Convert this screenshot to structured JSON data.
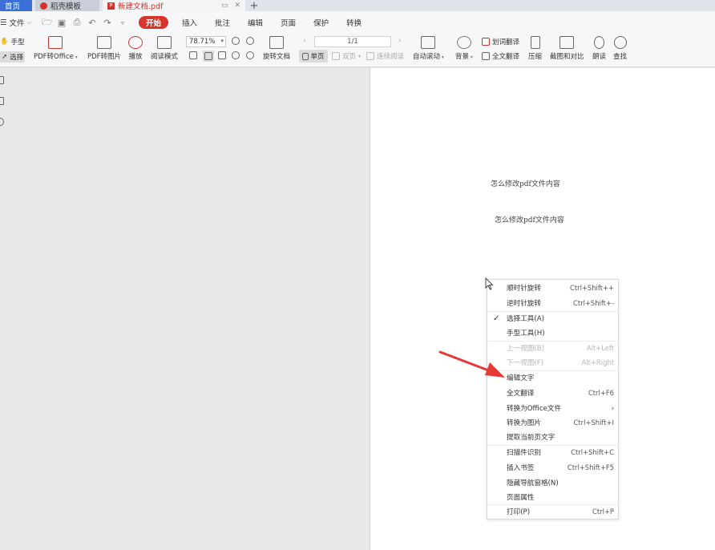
{
  "tabs": {
    "home": "首页",
    "template": "稻壳模板",
    "document": "新建文档.pdf"
  },
  "menu": {
    "file": "文件",
    "tabs": [
      "开始",
      "插入",
      "批注",
      "编辑",
      "页面",
      "保护",
      "转换"
    ]
  },
  "ribbon": {
    "hand_tool": "手型",
    "select_tool": "选择",
    "pdf_to_office": "PDF转Office",
    "pdf_to_image": "PDF转图片",
    "play": "播放",
    "read_mode": "阅读模式",
    "zoom_value": "78.71%",
    "rotate_doc": "旋转文档",
    "page_indicator": "1/1",
    "single_page": "单页",
    "double_page": "双页",
    "continuous_read": "连续阅读",
    "auto_scroll": "自动滚动",
    "background": "背景",
    "word_translate": "划词翻译",
    "full_translate": "全文翻译",
    "compress": "压缩",
    "screenshot_compare": "截图和对比",
    "read_aloud": "朗读",
    "find": "查找"
  },
  "document": {
    "line1": "怎么修改pdf文件内容",
    "line2": "怎么修改pdf文件内容"
  },
  "context_menu": {
    "items": [
      {
        "label": "顺时针旋转",
        "shortcut": "Ctrl+Shift++"
      },
      {
        "label": "逆时针旋转",
        "shortcut": "Ctrl+Shift+-"
      },
      {
        "label": "选择工具(A)",
        "shortcut": ""
      },
      {
        "label": "手型工具(H)",
        "shortcut": ""
      },
      {
        "label": "上一视图(B)",
        "shortcut": "Alt+Left"
      },
      {
        "label": "下一视图(F)",
        "shortcut": "Alt+Right"
      },
      {
        "label": "编辑文字",
        "shortcut": ""
      },
      {
        "label": "全文翻译",
        "shortcut": "Ctrl+F6"
      },
      {
        "label": "转换为Office文件",
        "shortcut": "›"
      },
      {
        "label": "转换为图片",
        "shortcut": "Ctrl+Shift+I"
      },
      {
        "label": "提取当前页文字",
        "shortcut": ""
      },
      {
        "label": "扫描件识别",
        "shortcut": "Ctrl+Shift+C"
      },
      {
        "label": "插入书签",
        "shortcut": "Ctrl+Shift+F5"
      },
      {
        "label": "隐藏导航窗格(N)",
        "shortcut": ""
      },
      {
        "label": "页面属性",
        "shortcut": ""
      },
      {
        "label": "打印(P)",
        "shortcut": "Ctrl+P"
      }
    ]
  },
  "colors": {
    "accent_red": "#d9352b",
    "home_tab_blue": "#3b6fd8",
    "arrow_red": "#e53935"
  }
}
